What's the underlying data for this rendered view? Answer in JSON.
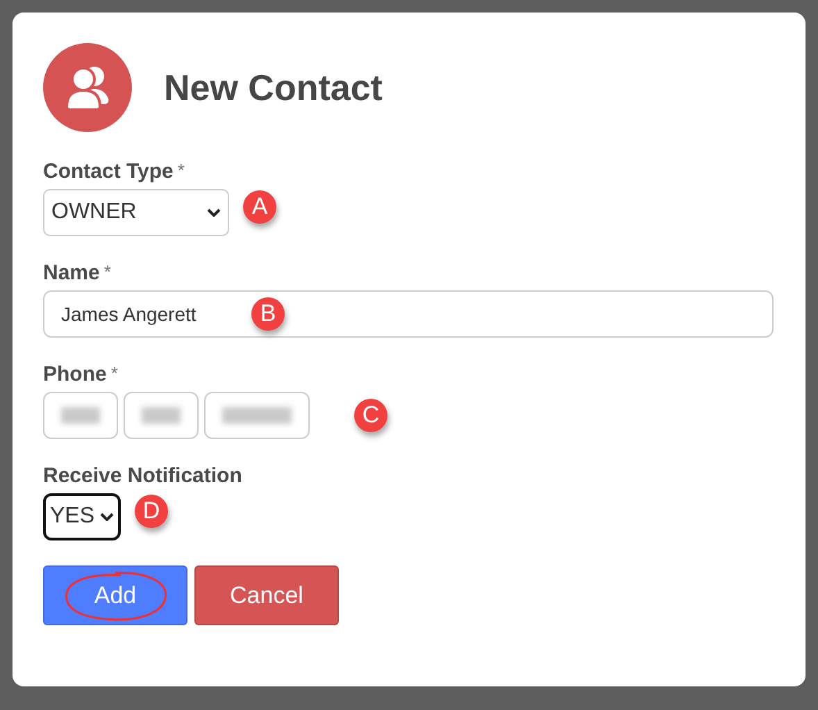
{
  "dialog": {
    "title": "New Contact",
    "fields": [
      {
        "kind": "select",
        "label": "Contact Type",
        "required_mark": "*",
        "value": "OWNER",
        "focused": false,
        "marker": "A"
      },
      {
        "kind": "text",
        "label": "Name",
        "required_mark": "*",
        "value": "James Angerett",
        "marker": "B"
      },
      {
        "kind": "phone",
        "label": "Phone",
        "required_mark": "*",
        "marker": "C"
      },
      {
        "kind": "select",
        "label": "Receive Notification",
        "value": "YES",
        "focused": true,
        "marker": "D"
      }
    ],
    "buttons": [
      {
        "label": "Add",
        "kind": "primary",
        "circled": true
      },
      {
        "label": "Cancel",
        "kind": "danger",
        "circled": false
      }
    ]
  }
}
